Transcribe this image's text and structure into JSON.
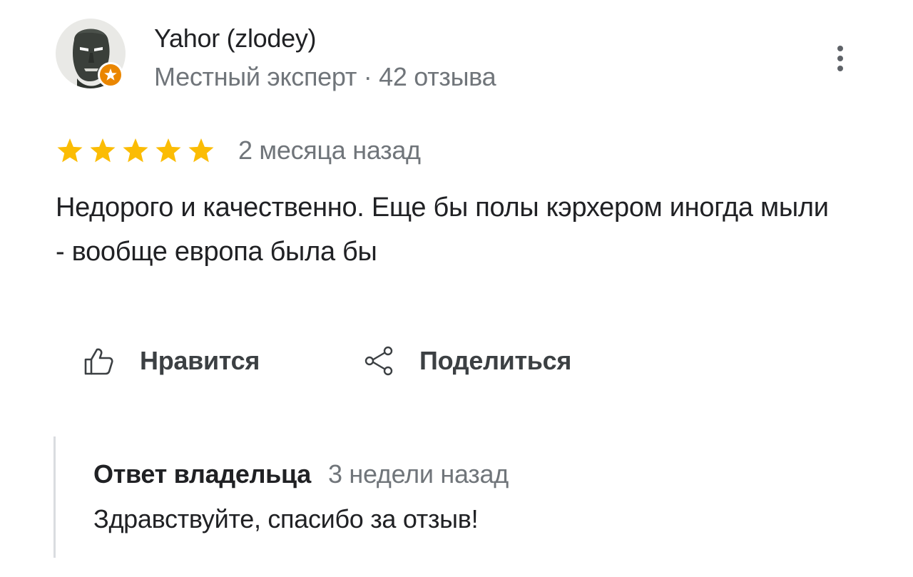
{
  "review": {
    "author": {
      "name": "Yahor (zlodey)",
      "meta": "Местный эксперт · 42 отзыва",
      "avatar_icon": "dark-mask-avatar",
      "badge_icon": "local-guide-star-badge",
      "badge_color": "#ea8600"
    },
    "more_icon": "more-vert-icon",
    "rating": {
      "stars": 5,
      "max": 5,
      "star_color": "#fbbc04"
    },
    "date": "2 месяца назад",
    "text": "Недорого и качественно. Еще бы полы кэрхером иногда мыли - вообще европа была бы"
  },
  "actions": {
    "like": {
      "label": "Нравится",
      "icon": "thumb-up-icon"
    },
    "share": {
      "label": "Поделиться",
      "icon": "share-icon"
    }
  },
  "owner_reply": {
    "title": "Ответ владельца",
    "date": "3 недели назад",
    "text": "Здравствуйте, спасибо за отзыв!"
  },
  "colors": {
    "primary_text": "#202124",
    "secondary_text": "#70757a",
    "action_text": "#3c4043",
    "divider": "#dadce0"
  }
}
